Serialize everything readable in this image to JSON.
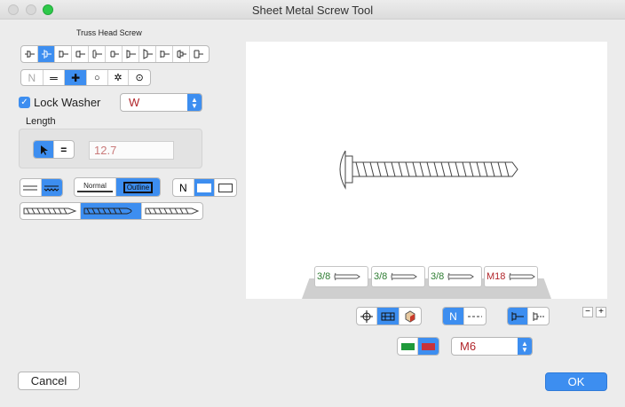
{
  "window": {
    "title": "Sheet Metal Screw Tool"
  },
  "head_type": {
    "label": "Truss Head Screw"
  },
  "drive": {
    "options": [
      "N",
      "═",
      "✚",
      "○",
      "✲",
      "⊙"
    ]
  },
  "lock_washer": {
    "label": "Lock Washer",
    "checked": true,
    "value": "W"
  },
  "length": {
    "label": "Length",
    "value": "12.7"
  },
  "display_mode": {
    "normal_label": "Normal",
    "outline_label": "Outline"
  },
  "view_mode": {
    "n_label": "N"
  },
  "presets": [
    {
      "size": "3/8",
      "color": "#2e7d32"
    },
    {
      "size": "3/8",
      "color": "#2e7d32"
    },
    {
      "size": "3/8",
      "color": "#2e7d32"
    },
    {
      "size": "M18",
      "color": "#b1252a"
    }
  ],
  "bottom": {
    "n_label": "N",
    "size_value": "M6"
  },
  "zoom": {
    "minus": "−",
    "plus": "+"
  },
  "buttons": {
    "cancel": "Cancel",
    "ok": "OK"
  },
  "colors": {
    "accent": "#3d8ef0",
    "metric_red": "#b1252a",
    "imperial_green": "#2e7d32"
  }
}
